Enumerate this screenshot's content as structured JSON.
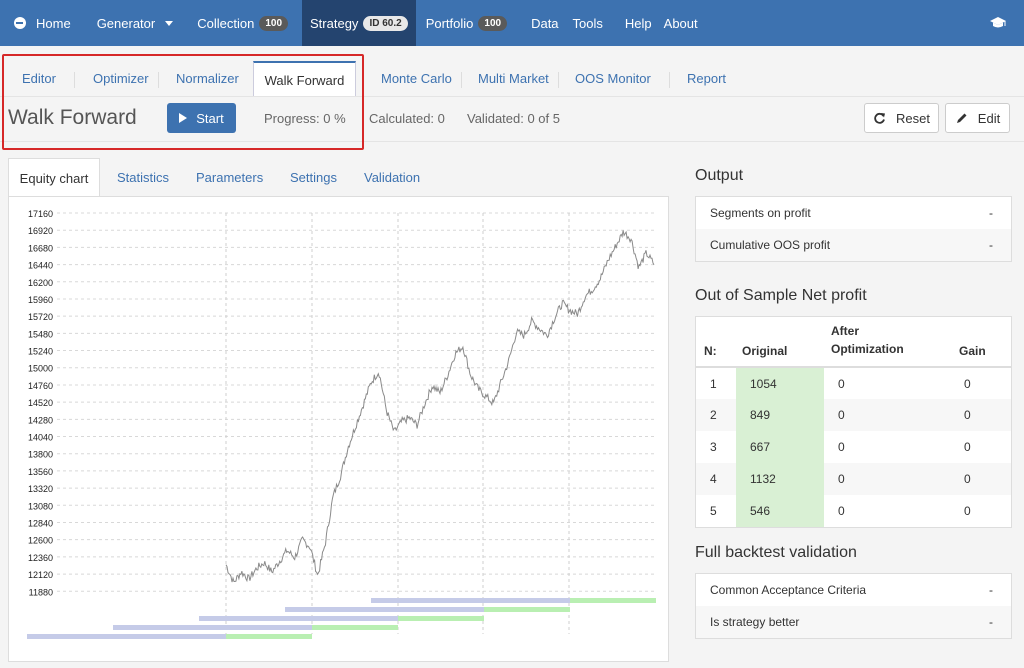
{
  "nav": {
    "items": [
      {
        "label": "Home"
      },
      {
        "label": "Generator"
      },
      {
        "label": "Collection",
        "badge": "100"
      },
      {
        "label": "Strategy",
        "badge": "ID 60.2"
      },
      {
        "label": "Portfolio",
        "badge": "100"
      },
      {
        "label": "Data"
      },
      {
        "label": "Tools"
      },
      {
        "label": "Help"
      },
      {
        "label": "About"
      }
    ]
  },
  "subtabs": [
    "Editor",
    "Optimizer",
    "Normalizer",
    "Walk Forward",
    "Monte Carlo",
    "Multi Market",
    "OOS Monitor",
    "Report"
  ],
  "header": {
    "title": "Walk Forward",
    "start_label": "Start",
    "progress": "Progress: 0 %",
    "calculated": "Calculated: 0",
    "validated": "Validated: 0 of 5",
    "reset_label": "Reset",
    "edit_label": "Edit"
  },
  "left_tabs": [
    "Equity chart",
    "Statistics",
    "Parameters",
    "Settings",
    "Validation"
  ],
  "chart_data": {
    "type": "line",
    "title": "",
    "ylim": [
      11800,
      17160
    ],
    "y_ticks": [
      17160,
      16920,
      16680,
      16440,
      16200,
      15960,
      15720,
      15480,
      15240,
      15000,
      14760,
      14520,
      14280,
      14040,
      13800,
      13560,
      13320,
      13080,
      12840,
      12600,
      12360,
      12120,
      11880
    ],
    "series": [
      {
        "values": [
          12250,
          12000,
          12150,
          12050,
          12200,
          12280,
          12150,
          12300,
          12450,
          12350,
          12600,
          12500,
          12100,
          12550,
          13200,
          13500,
          13900,
          14200,
          14500,
          14800,
          14950,
          14400,
          14100,
          14250,
          14300,
          14200,
          14500,
          14750,
          14650,
          14900,
          15200,
          15300,
          14900,
          14700,
          14600,
          14500,
          14800,
          15100,
          15500,
          15450,
          15650,
          15550,
          15450,
          15700,
          15900,
          15800,
          15750,
          16000,
          16100,
          16250,
          16500,
          16700,
          16900,
          16800,
          16400,
          16600,
          16450
        ]
      }
    ],
    "grid": true,
    "walk_forward_segments": 5
  },
  "output": {
    "title": "Output",
    "rows": [
      {
        "label": "Segments on profit",
        "value": "-"
      },
      {
        "label": "Cumulative OOS profit",
        "value": "-"
      }
    ]
  },
  "oos": {
    "title": "Out of Sample Net profit",
    "headers": {
      "n": "N:",
      "original": "Original",
      "after": "After Optimization",
      "gain": "Gain"
    },
    "rows": [
      {
        "n": "1",
        "original": "1054",
        "after": "0",
        "gain": "0"
      },
      {
        "n": "2",
        "original": "849",
        "after": "0",
        "gain": "0"
      },
      {
        "n": "3",
        "original": "667",
        "after": "0",
        "gain": "0"
      },
      {
        "n": "4",
        "original": "1132",
        "after": "0",
        "gain": "0"
      },
      {
        "n": "5",
        "original": "546",
        "after": "0",
        "gain": "0"
      }
    ]
  },
  "validation": {
    "title": "Full backtest validation",
    "rows": [
      {
        "label": "Common Acceptance Criteria",
        "value": "-"
      },
      {
        "label": "Is strategy better",
        "value": "-"
      }
    ]
  },
  "colors": {
    "nav_bg": "#3d72b0",
    "nav_active": "#24446f",
    "highlight": "#d62828",
    "is_segment": "#c5cbe8",
    "oos_segment": "#b9efb2",
    "original_cell": "#d9f0d4"
  }
}
